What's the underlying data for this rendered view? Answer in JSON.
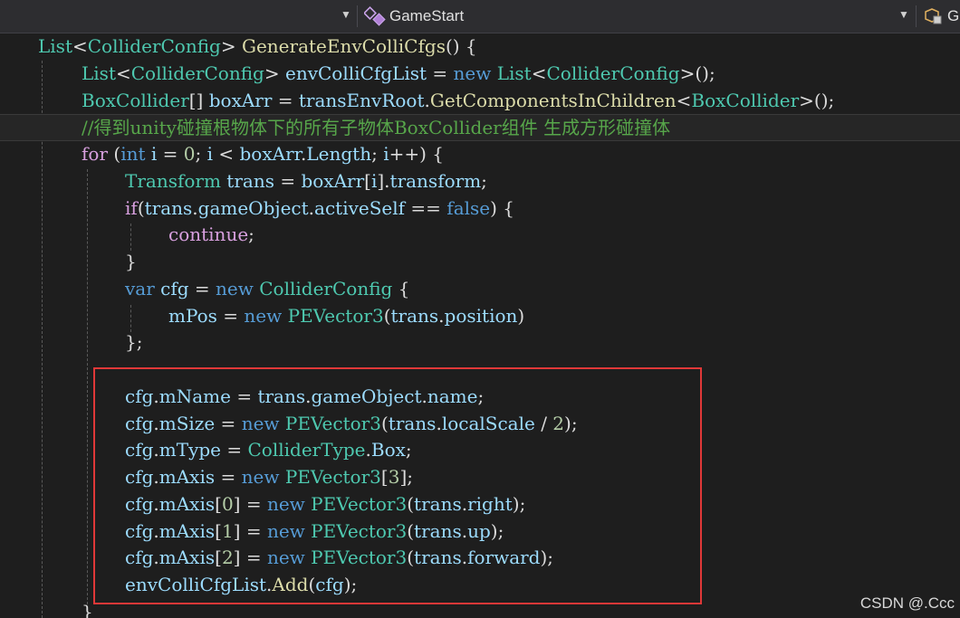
{
  "editor": {
    "nav_bar": {
      "member_dropdown": {
        "label": "GameStart",
        "icon": "method-icon"
      },
      "right_dropdown": {
        "label": "G",
        "icon": "class-icon"
      }
    },
    "code_lines": [
      {
        "indent": 1,
        "tokens": [
          [
            "ty",
            "List"
          ],
          [
            "pl",
            "<"
          ],
          [
            "ty",
            "ColliderConfig"
          ],
          [
            "pl",
            "> "
          ],
          [
            "fn",
            "GenerateEnvColliCfgs"
          ],
          [
            "pl",
            "() {"
          ]
        ]
      },
      {
        "indent": 2,
        "tokens": [
          [
            "ty",
            "List"
          ],
          [
            "pl",
            "<"
          ],
          [
            "ty",
            "ColliderConfig"
          ],
          [
            "pl",
            "> "
          ],
          [
            "vr",
            "envColliCfgList"
          ],
          [
            "pl",
            " = "
          ],
          [
            "kw",
            "new"
          ],
          [
            "pl",
            " "
          ],
          [
            "ty",
            "List"
          ],
          [
            "pl",
            "<"
          ],
          [
            "ty",
            "ColliderConfig"
          ],
          [
            "pl",
            ">();"
          ]
        ]
      },
      {
        "indent": 2,
        "tokens": [
          [
            "ty",
            "BoxCollider"
          ],
          [
            "pl",
            "[] "
          ],
          [
            "vr",
            "boxArr"
          ],
          [
            "pl",
            " = "
          ],
          [
            "vr",
            "transEnvRoot"
          ],
          [
            "pl",
            "."
          ],
          [
            "fn",
            "GetComponentsInChildren"
          ],
          [
            "pl",
            "<"
          ],
          [
            "ty",
            "BoxCollider"
          ],
          [
            "pl",
            ">();"
          ]
        ]
      },
      {
        "indent": 2,
        "highlight": true,
        "tokens": [
          [
            "cm",
            "//得到unity碰撞根物体下的所有子物体BoxCollider组件 生成方形碰撞体"
          ]
        ]
      },
      {
        "indent": 2,
        "tokens": [
          [
            "ctl",
            "for"
          ],
          [
            "pl",
            " ("
          ],
          [
            "kw",
            "int"
          ],
          [
            "pl",
            " "
          ],
          [
            "vr",
            "i"
          ],
          [
            "pl",
            " = "
          ],
          [
            "nm",
            "0"
          ],
          [
            "pl",
            "; "
          ],
          [
            "vr",
            "i"
          ],
          [
            "pl",
            " < "
          ],
          [
            "vr",
            "boxArr"
          ],
          [
            "pl",
            "."
          ],
          [
            "vr",
            "Length"
          ],
          [
            "pl",
            "; "
          ],
          [
            "vr",
            "i"
          ],
          [
            "pl",
            "++) {"
          ]
        ]
      },
      {
        "indent": 3,
        "tokens": [
          [
            "ty",
            "Transform"
          ],
          [
            "pl",
            " "
          ],
          [
            "vr",
            "trans"
          ],
          [
            "pl",
            " = "
          ],
          [
            "vr",
            "boxArr"
          ],
          [
            "pl",
            "["
          ],
          [
            "vr",
            "i"
          ],
          [
            "pl",
            "]."
          ],
          [
            "vr",
            "transform"
          ],
          [
            "pl",
            ";"
          ]
        ]
      },
      {
        "indent": 3,
        "tokens": [
          [
            "ctl",
            "if"
          ],
          [
            "pl",
            "("
          ],
          [
            "vr",
            "trans"
          ],
          [
            "pl",
            "."
          ],
          [
            "vr",
            "gameObject"
          ],
          [
            "pl",
            "."
          ],
          [
            "vr",
            "activeSelf"
          ],
          [
            "pl",
            " == "
          ],
          [
            "kw",
            "false"
          ],
          [
            "pl",
            ") {"
          ]
        ]
      },
      {
        "indent": 4,
        "tokens": [
          [
            "ctl",
            "continue"
          ],
          [
            "pl",
            ";"
          ]
        ]
      },
      {
        "indent": 3,
        "tokens": [
          [
            "pl",
            "}"
          ]
        ]
      },
      {
        "indent": 3,
        "tokens": [
          [
            "kw",
            "var"
          ],
          [
            "pl",
            " "
          ],
          [
            "vr",
            "cfg"
          ],
          [
            "pl",
            " = "
          ],
          [
            "kw",
            "new"
          ],
          [
            "pl",
            " "
          ],
          [
            "ty",
            "ColliderConfig"
          ],
          [
            "pl",
            " {"
          ]
        ]
      },
      {
        "indent": 4,
        "tokens": [
          [
            "vr",
            "mPos"
          ],
          [
            "pl",
            " = "
          ],
          [
            "kw",
            "new"
          ],
          [
            "pl",
            " "
          ],
          [
            "ty",
            "PEVector3"
          ],
          [
            "pl",
            "("
          ],
          [
            "vr",
            "trans"
          ],
          [
            "pl",
            "."
          ],
          [
            "vr",
            "position"
          ],
          [
            "pl",
            ")"
          ]
        ]
      },
      {
        "indent": 3,
        "tokens": [
          [
            "pl",
            "};"
          ]
        ]
      },
      {
        "indent": 3,
        "tokens": []
      },
      {
        "indent": 3,
        "tokens": [
          [
            "vr",
            "cfg"
          ],
          [
            "pl",
            "."
          ],
          [
            "vr",
            "mName"
          ],
          [
            "pl",
            " = "
          ],
          [
            "vr",
            "trans"
          ],
          [
            "pl",
            "."
          ],
          [
            "vr",
            "gameObject"
          ],
          [
            "pl",
            "."
          ],
          [
            "vr",
            "name"
          ],
          [
            "pl",
            ";"
          ]
        ]
      },
      {
        "indent": 3,
        "tokens": [
          [
            "vr",
            "cfg"
          ],
          [
            "pl",
            "."
          ],
          [
            "vr",
            "mSize"
          ],
          [
            "pl",
            " = "
          ],
          [
            "kw",
            "new"
          ],
          [
            "pl",
            " "
          ],
          [
            "ty",
            "PEVector3"
          ],
          [
            "pl",
            "("
          ],
          [
            "vr",
            "trans"
          ],
          [
            "pl",
            "."
          ],
          [
            "vr",
            "localScale"
          ],
          [
            "pl",
            " / "
          ],
          [
            "nm",
            "2"
          ],
          [
            "pl",
            ");"
          ]
        ]
      },
      {
        "indent": 3,
        "tokens": [
          [
            "vr",
            "cfg"
          ],
          [
            "pl",
            "."
          ],
          [
            "vr",
            "mType"
          ],
          [
            "pl",
            " = "
          ],
          [
            "ty",
            "ColliderType"
          ],
          [
            "pl",
            "."
          ],
          [
            "vr",
            "Box"
          ],
          [
            "pl",
            ";"
          ]
        ]
      },
      {
        "indent": 3,
        "tokens": [
          [
            "vr",
            "cfg"
          ],
          [
            "pl",
            "."
          ],
          [
            "vr",
            "mAxis"
          ],
          [
            "pl",
            " = "
          ],
          [
            "kw",
            "new"
          ],
          [
            "pl",
            " "
          ],
          [
            "ty",
            "PEVector3"
          ],
          [
            "pl",
            "["
          ],
          [
            "nm",
            "3"
          ],
          [
            "pl",
            "];"
          ]
        ]
      },
      {
        "indent": 3,
        "tokens": [
          [
            "vr",
            "cfg"
          ],
          [
            "pl",
            "."
          ],
          [
            "vr",
            "mAxis"
          ],
          [
            "pl",
            "["
          ],
          [
            "nm",
            "0"
          ],
          [
            "pl",
            "] = "
          ],
          [
            "kw",
            "new"
          ],
          [
            "pl",
            " "
          ],
          [
            "ty",
            "PEVector3"
          ],
          [
            "pl",
            "("
          ],
          [
            "vr",
            "trans"
          ],
          [
            "pl",
            "."
          ],
          [
            "vr",
            "right"
          ],
          [
            "pl",
            ");"
          ]
        ]
      },
      {
        "indent": 3,
        "tokens": [
          [
            "vr",
            "cfg"
          ],
          [
            "pl",
            "."
          ],
          [
            "vr",
            "mAxis"
          ],
          [
            "pl",
            "["
          ],
          [
            "nm",
            "1"
          ],
          [
            "pl",
            "] = "
          ],
          [
            "kw",
            "new"
          ],
          [
            "pl",
            " "
          ],
          [
            "ty",
            "PEVector3"
          ],
          [
            "pl",
            "("
          ],
          [
            "vr",
            "trans"
          ],
          [
            "pl",
            "."
          ],
          [
            "vr",
            "up"
          ],
          [
            "pl",
            ");"
          ]
        ]
      },
      {
        "indent": 3,
        "tokens": [
          [
            "vr",
            "cfg"
          ],
          [
            "pl",
            "."
          ],
          [
            "vr",
            "mAxis"
          ],
          [
            "pl",
            "["
          ],
          [
            "nm",
            "2"
          ],
          [
            "pl",
            "] = "
          ],
          [
            "kw",
            "new"
          ],
          [
            "pl",
            " "
          ],
          [
            "ty",
            "PEVector3"
          ],
          [
            "pl",
            "("
          ],
          [
            "vr",
            "trans"
          ],
          [
            "pl",
            "."
          ],
          [
            "vr",
            "forward"
          ],
          [
            "pl",
            ");"
          ]
        ]
      },
      {
        "indent": 3,
        "tokens": [
          [
            "vr",
            "envColliCfgList"
          ],
          [
            "pl",
            "."
          ],
          [
            "fn",
            "Add"
          ],
          [
            "pl",
            "("
          ],
          [
            "vr",
            "cfg"
          ],
          [
            "pl",
            ");"
          ]
        ]
      },
      {
        "indent": 2,
        "tokens": [
          [
            "pl",
            "}"
          ]
        ]
      }
    ]
  },
  "watermark": "CSDN @.Ccc",
  "colors": {
    "background": "#1e1e1e",
    "keyword": "#569cd6",
    "type": "#4ec9b0",
    "method": "#dcdcaa",
    "variable": "#9cdcfe",
    "comment": "#57a64a",
    "control": "#d8a0df",
    "number": "#b5cea8",
    "highlight_box": "#e03838"
  }
}
